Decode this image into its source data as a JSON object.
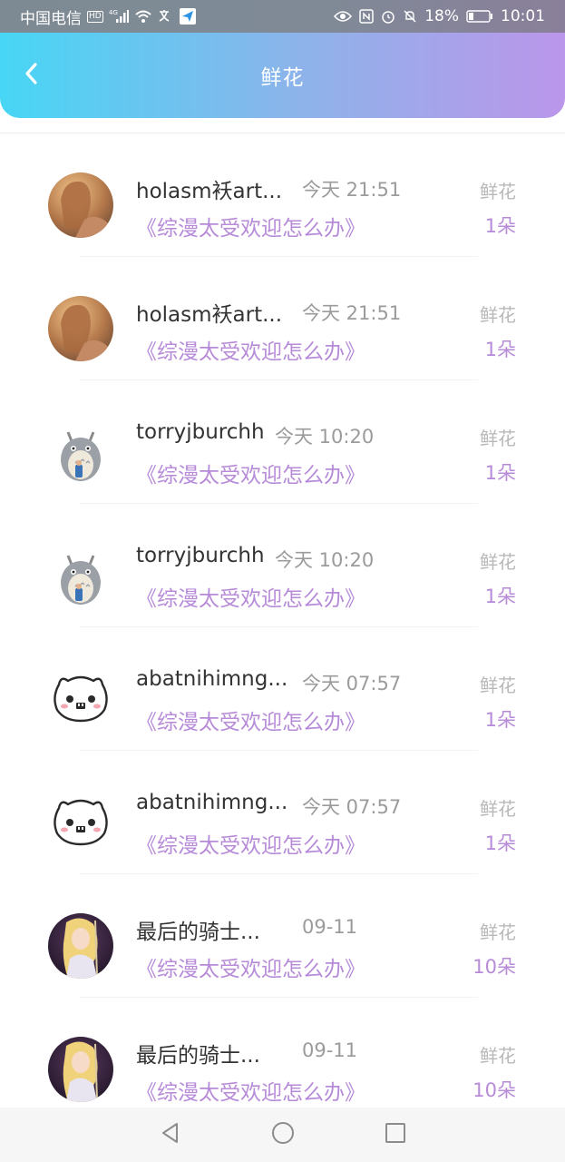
{
  "status_bar": {
    "carrier": "中国电信",
    "hd_badge": "HD",
    "network": "4G",
    "battery_percent": "18%",
    "time": "10:01",
    "icons": [
      "signal-icon",
      "wifi-icon",
      "translate-icon",
      "send-icon",
      "eye-icon",
      "nfc-icon",
      "alarm-icon",
      "mute-icon",
      "battery-icon"
    ]
  },
  "header": {
    "title": "鲜花",
    "back_icon": "chevron-left-icon"
  },
  "records": [
    {
      "name": "holasm袄art...",
      "time": "今天 21:51",
      "book": "《综漫太受欢迎怎么办》",
      "gift_label": "鲜花",
      "gift_count": "1朵",
      "avatar": "photo-girl-avatar"
    },
    {
      "name": "holasm袄art...",
      "time": "今天 21:51",
      "book": "《综漫太受欢迎怎么办》",
      "gift_label": "鲜花",
      "gift_count": "1朵",
      "avatar": "photo-girl-avatar"
    },
    {
      "name": "torryjburchh",
      "time": "今天 10:20",
      "book": "《综漫太受欢迎怎么办》",
      "gift_label": "鲜花",
      "gift_count": "1朵",
      "avatar": "totoro-avatar"
    },
    {
      "name": "torryjburchh",
      "time": "今天 10:20",
      "book": "《综漫太受欢迎怎么办》",
      "gift_label": "鲜花",
      "gift_count": "1朵",
      "avatar": "totoro-avatar"
    },
    {
      "name": "abatnihimng...",
      "time": "今天 07:57",
      "book": "《综漫太受欢迎怎么办》",
      "gift_label": "鲜花",
      "gift_count": "1朵",
      "avatar": "cartoon-face-avatar"
    },
    {
      "name": "abatnihimng...",
      "time": "今天 07:57",
      "book": "《综漫太受欢迎怎么办》",
      "gift_label": "鲜花",
      "gift_count": "1朵",
      "avatar": "cartoon-face-avatar"
    },
    {
      "name": "最后的骑士...",
      "time": "09-11",
      "book": "《综漫太受欢迎怎么办》",
      "gift_label": "鲜花",
      "gift_count": "10朵",
      "avatar": "anime-girl-avatar"
    },
    {
      "name": "最后的骑士...",
      "time": "09-11",
      "book": "《综漫太受欢迎怎么办》",
      "gift_label": "鲜花",
      "gift_count": "10朵",
      "avatar": "anime-girl-avatar"
    }
  ],
  "nav_bar": {
    "buttons": [
      "back-triangle-icon",
      "home-circle-icon",
      "recents-square-icon"
    ]
  },
  "colors": {
    "header_gradient_start": "#47d6f5",
    "header_gradient_end": "#bb96ea",
    "accent_purple": "#b78bd8",
    "muted_gray": "#9b9b9b"
  }
}
